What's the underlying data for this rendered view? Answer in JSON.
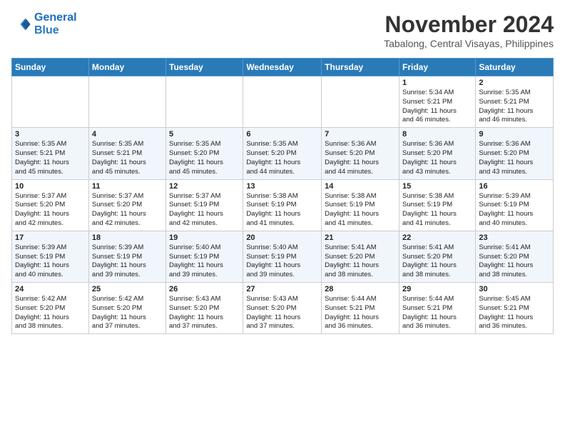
{
  "header": {
    "logo_line1": "General",
    "logo_line2": "Blue",
    "month_title": "November 2024",
    "subtitle": "Tabalong, Central Visayas, Philippines"
  },
  "weekdays": [
    "Sunday",
    "Monday",
    "Tuesday",
    "Wednesday",
    "Thursday",
    "Friday",
    "Saturday"
  ],
  "weeks": [
    [
      {
        "day": "",
        "info": ""
      },
      {
        "day": "",
        "info": ""
      },
      {
        "day": "",
        "info": ""
      },
      {
        "day": "",
        "info": ""
      },
      {
        "day": "",
        "info": ""
      },
      {
        "day": "1",
        "info": "Sunrise: 5:34 AM\nSunset: 5:21 PM\nDaylight: 11 hours\nand 46 minutes."
      },
      {
        "day": "2",
        "info": "Sunrise: 5:35 AM\nSunset: 5:21 PM\nDaylight: 11 hours\nand 46 minutes."
      }
    ],
    [
      {
        "day": "3",
        "info": "Sunrise: 5:35 AM\nSunset: 5:21 PM\nDaylight: 11 hours\nand 45 minutes."
      },
      {
        "day": "4",
        "info": "Sunrise: 5:35 AM\nSunset: 5:21 PM\nDaylight: 11 hours\nand 45 minutes."
      },
      {
        "day": "5",
        "info": "Sunrise: 5:35 AM\nSunset: 5:20 PM\nDaylight: 11 hours\nand 45 minutes."
      },
      {
        "day": "6",
        "info": "Sunrise: 5:35 AM\nSunset: 5:20 PM\nDaylight: 11 hours\nand 44 minutes."
      },
      {
        "day": "7",
        "info": "Sunrise: 5:36 AM\nSunset: 5:20 PM\nDaylight: 11 hours\nand 44 minutes."
      },
      {
        "day": "8",
        "info": "Sunrise: 5:36 AM\nSunset: 5:20 PM\nDaylight: 11 hours\nand 43 minutes."
      },
      {
        "day": "9",
        "info": "Sunrise: 5:36 AM\nSunset: 5:20 PM\nDaylight: 11 hours\nand 43 minutes."
      }
    ],
    [
      {
        "day": "10",
        "info": "Sunrise: 5:37 AM\nSunset: 5:20 PM\nDaylight: 11 hours\nand 42 minutes."
      },
      {
        "day": "11",
        "info": "Sunrise: 5:37 AM\nSunset: 5:20 PM\nDaylight: 11 hours\nand 42 minutes."
      },
      {
        "day": "12",
        "info": "Sunrise: 5:37 AM\nSunset: 5:19 PM\nDaylight: 11 hours\nand 42 minutes."
      },
      {
        "day": "13",
        "info": "Sunrise: 5:38 AM\nSunset: 5:19 PM\nDaylight: 11 hours\nand 41 minutes."
      },
      {
        "day": "14",
        "info": "Sunrise: 5:38 AM\nSunset: 5:19 PM\nDaylight: 11 hours\nand 41 minutes."
      },
      {
        "day": "15",
        "info": "Sunrise: 5:38 AM\nSunset: 5:19 PM\nDaylight: 11 hours\nand 41 minutes."
      },
      {
        "day": "16",
        "info": "Sunrise: 5:39 AM\nSunset: 5:19 PM\nDaylight: 11 hours\nand 40 minutes."
      }
    ],
    [
      {
        "day": "17",
        "info": "Sunrise: 5:39 AM\nSunset: 5:19 PM\nDaylight: 11 hours\nand 40 minutes."
      },
      {
        "day": "18",
        "info": "Sunrise: 5:39 AM\nSunset: 5:19 PM\nDaylight: 11 hours\nand 39 minutes."
      },
      {
        "day": "19",
        "info": "Sunrise: 5:40 AM\nSunset: 5:19 PM\nDaylight: 11 hours\nand 39 minutes."
      },
      {
        "day": "20",
        "info": "Sunrise: 5:40 AM\nSunset: 5:19 PM\nDaylight: 11 hours\nand 39 minutes."
      },
      {
        "day": "21",
        "info": "Sunrise: 5:41 AM\nSunset: 5:20 PM\nDaylight: 11 hours\nand 38 minutes."
      },
      {
        "day": "22",
        "info": "Sunrise: 5:41 AM\nSunset: 5:20 PM\nDaylight: 11 hours\nand 38 minutes."
      },
      {
        "day": "23",
        "info": "Sunrise: 5:41 AM\nSunset: 5:20 PM\nDaylight: 11 hours\nand 38 minutes."
      }
    ],
    [
      {
        "day": "24",
        "info": "Sunrise: 5:42 AM\nSunset: 5:20 PM\nDaylight: 11 hours\nand 38 minutes."
      },
      {
        "day": "25",
        "info": "Sunrise: 5:42 AM\nSunset: 5:20 PM\nDaylight: 11 hours\nand 37 minutes."
      },
      {
        "day": "26",
        "info": "Sunrise: 5:43 AM\nSunset: 5:20 PM\nDaylight: 11 hours\nand 37 minutes."
      },
      {
        "day": "27",
        "info": "Sunrise: 5:43 AM\nSunset: 5:20 PM\nDaylight: 11 hours\nand 37 minutes."
      },
      {
        "day": "28",
        "info": "Sunrise: 5:44 AM\nSunset: 5:21 PM\nDaylight: 11 hours\nand 36 minutes."
      },
      {
        "day": "29",
        "info": "Sunrise: 5:44 AM\nSunset: 5:21 PM\nDaylight: 11 hours\nand 36 minutes."
      },
      {
        "day": "30",
        "info": "Sunrise: 5:45 AM\nSunset: 5:21 PM\nDaylight: 11 hours\nand 36 minutes."
      }
    ]
  ]
}
